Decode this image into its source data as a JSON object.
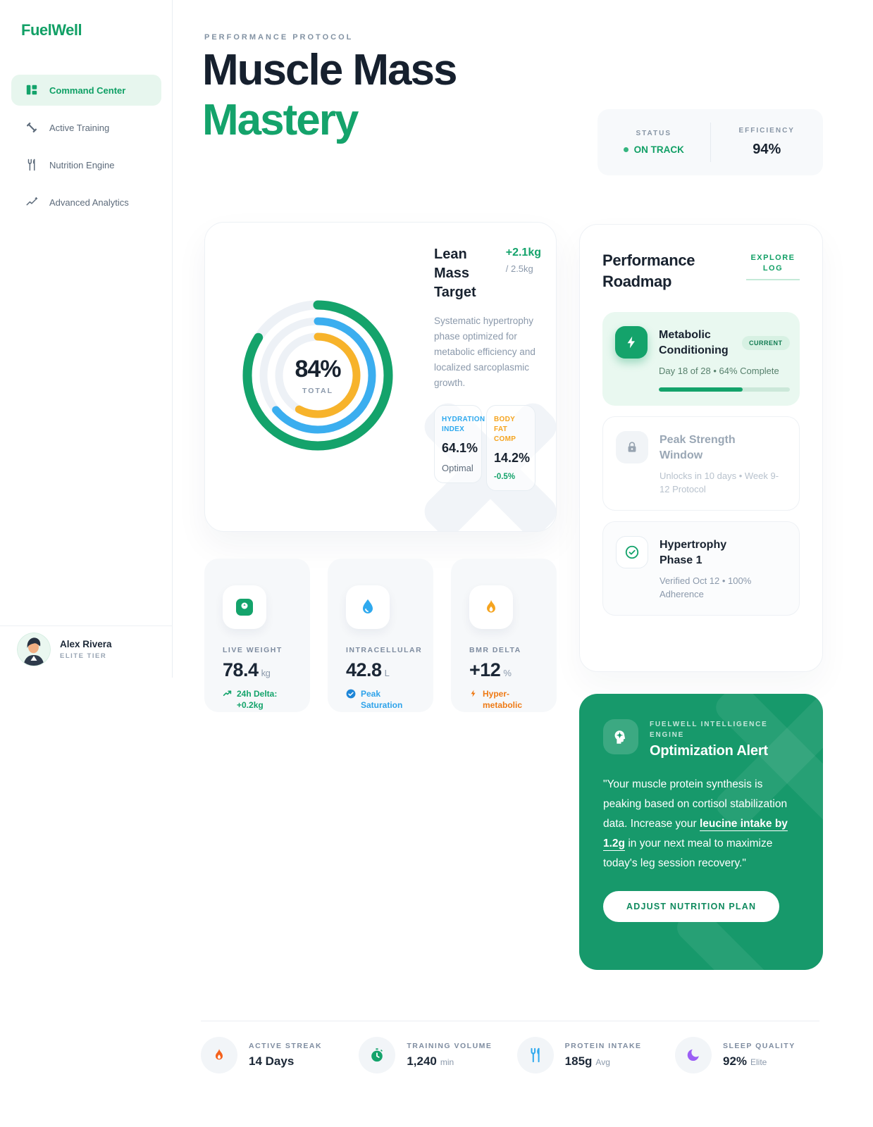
{
  "brand": {
    "name": "FuelWell"
  },
  "sidebar": {
    "items": [
      {
        "label": "Command Center"
      },
      {
        "label": "Active Training"
      },
      {
        "label": "Nutrition Engine"
      },
      {
        "label": "Advanced Analytics"
      }
    ],
    "profile": {
      "name": "Alex Rivera",
      "tier": "ELITE TIER"
    }
  },
  "header": {
    "eyebrow": "PERFORMANCE PROTOCOL",
    "title_line1": "Muscle Mass",
    "title_line2": "Mastery",
    "status": {
      "label": "STATUS",
      "value": "ON TRACK"
    },
    "efficiency": {
      "label": "EFFICIENCY",
      "value": "94%"
    }
  },
  "hero": {
    "total_percent": "84%",
    "total_label": "TOTAL",
    "rings": [
      {
        "name": "total",
        "percent": 84,
        "color": "#14A36B"
      },
      {
        "name": "hydration",
        "percent": 64,
        "color": "#3BAEEF"
      },
      {
        "name": "inner",
        "percent": 58,
        "color": "#F7B32B"
      }
    ],
    "target_title": "Lean Mass Target",
    "target_delta": "+2.1kg",
    "target_goal": "/ 2.5kg",
    "description": "Systematic hypertrophy phase optimized for metabolic efficiency and localized sarcoplasmic growth.",
    "stats": [
      {
        "label": "HYDRATION INDEX",
        "value": "64.1%",
        "note": "Optimal",
        "color": "#2FA9EE"
      },
      {
        "label": "BODY FAT COMP",
        "value": "14.2%",
        "note": "-0.5%",
        "color": "#F5A41F"
      }
    ]
  },
  "metrics": [
    {
      "label": "LIVE WEIGHT",
      "value": "78.4",
      "unit": "kg",
      "note": "24h Delta: +0.2kg",
      "icon": "scale-icon",
      "accent": "#14A36B"
    },
    {
      "label": "INTRACELLULAR",
      "value": "42.8",
      "unit": "L",
      "note": "Peak Saturation",
      "icon": "droplet-icon",
      "accent": "#2FA9EE"
    },
    {
      "label": "BMR DELTA",
      "value": "+12",
      "unit": "%",
      "note": "Hyper-metabolic",
      "icon": "flame-icon",
      "accent": "#EE7A15"
    }
  ],
  "roadmap": {
    "title": "Performance Roadmap",
    "action": "EXPLORE LOG",
    "items": [
      {
        "title": "Metabolic Conditioning",
        "badge": "CURRENT",
        "subtitle": "Day 18 of 28 • 64% Complete",
        "progress": 64,
        "state": "current"
      },
      {
        "title": "Peak Strength Window",
        "subtitle": "Unlocks in 10 days • Week 9-12 Protocol",
        "state": "locked"
      },
      {
        "title": "Hypertrophy Phase 1",
        "subtitle": "Verified Oct 12 • 100% Adherence",
        "state": "done"
      }
    ]
  },
  "alert": {
    "eyebrow": "FUELWELL INTELLIGENCE ENGINE",
    "title": "Optimization Alert",
    "quote_pre": "\"Your muscle protein synthesis is peaking based on cortisol stabilization data. Increase your ",
    "quote_key": "leucine intake by 1.2g",
    "quote_post": " in your next meal to maximize today's leg session recovery.\"",
    "button": "ADJUST NUTRITION PLAN"
  },
  "footer_stats": [
    {
      "label": "ACTIVE STREAK",
      "value": "14 Days",
      "unit": "",
      "icon": "flame-icon",
      "color": "#F4611C"
    },
    {
      "label": "TRAINING VOLUME",
      "value": "1,240",
      "unit": "min",
      "icon": "stopwatch-icon",
      "color": "#14A36B"
    },
    {
      "label": "PROTEIN INTAKE",
      "value": "185g",
      "unit": "Avg",
      "icon": "utensils-icon",
      "color": "#2FA9EE"
    },
    {
      "label": "SLEEP QUALITY",
      "value": "92%",
      "unit": "Elite",
      "icon": "moon-icon",
      "color": "#9B5EF5"
    }
  ]
}
